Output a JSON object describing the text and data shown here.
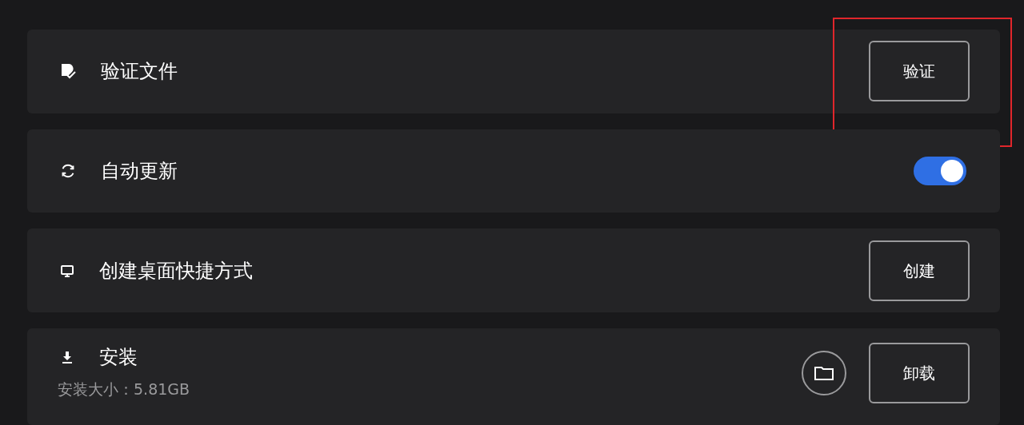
{
  "settings": [
    {
      "kind": "button",
      "label": "验证文件",
      "button": "验证",
      "highlighted": true
    },
    {
      "kind": "toggle",
      "label": "自动更新",
      "on": true
    },
    {
      "kind": "button",
      "label": "创建桌面快捷方式",
      "button": "创建",
      "highlighted": false
    },
    {
      "kind": "install",
      "label": "安装",
      "detail": "安装大小：5.81GB",
      "button": "卸载"
    }
  ]
}
